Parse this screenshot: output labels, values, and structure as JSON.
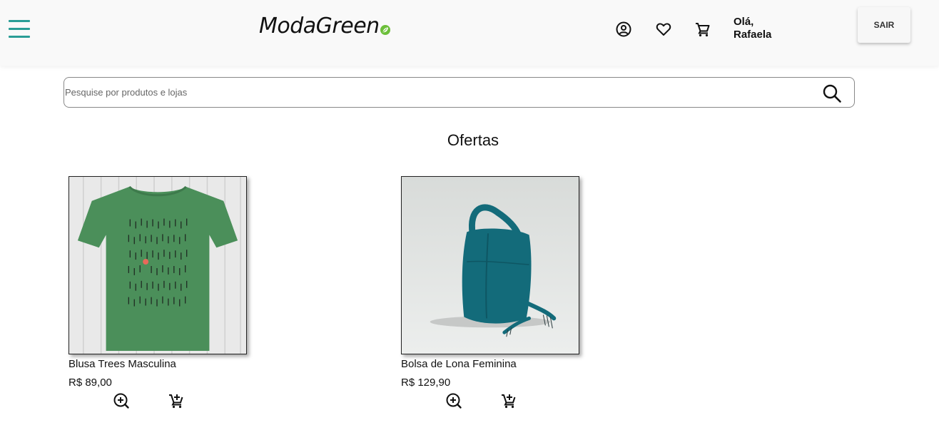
{
  "header": {
    "logo_text": "ModaGreen",
    "greeting_line1": "Olá,",
    "greeting_line2": "Rafaela",
    "logout_label": "SAIR",
    "icons": [
      "menu-icon",
      "account-icon",
      "heart-icon",
      "cart-icon"
    ]
  },
  "search": {
    "placeholder": "Pesquise por produtos e lojas",
    "value": ""
  },
  "offers": {
    "title": "Ofertas",
    "products": [
      {
        "name": "Blusa Trees Masculina",
        "price": "R$ 89,00"
      },
      {
        "name": "Bolsa de Lona Feminina",
        "price": "R$ 129,90"
      }
    ]
  },
  "colors": {
    "menu_accent": "#2a9d96",
    "logo_leaf": "#6cbf3a",
    "shirt_green": "#4b8f5a",
    "bag_teal": "#136b7a"
  }
}
